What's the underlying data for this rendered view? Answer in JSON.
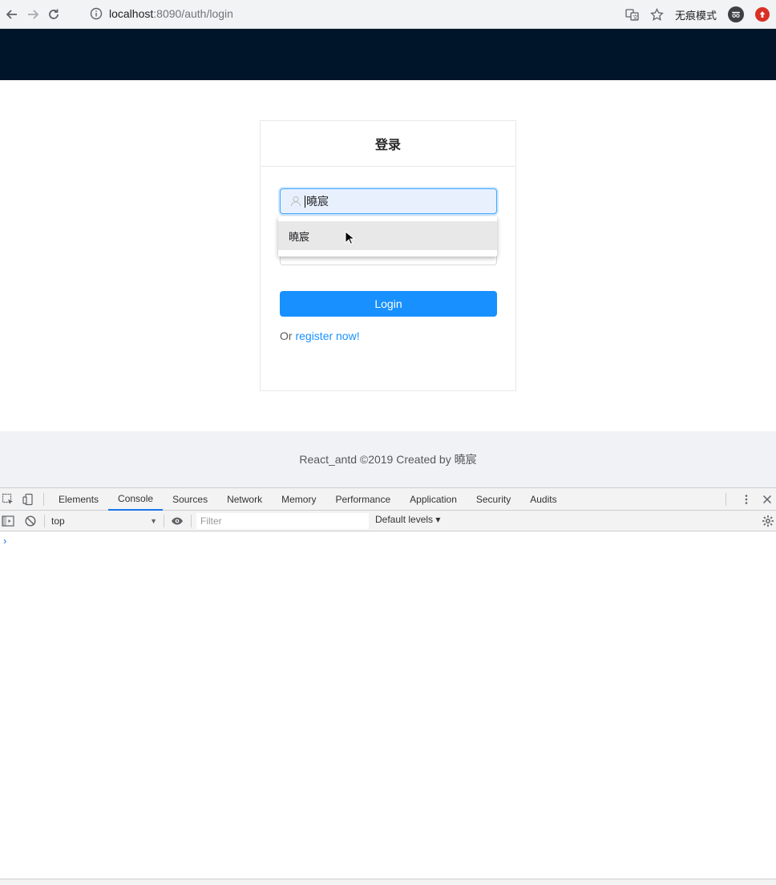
{
  "browser": {
    "url_host": "localhost",
    "url_rest": ":8090/auth/login",
    "incognito_label": "无痕模式"
  },
  "login": {
    "title": "登录",
    "username_value": "曉宸",
    "login_button": "Login",
    "register_prefix": "Or ",
    "register_link": "register now!"
  },
  "autocomplete": {
    "items": [
      "曉宸"
    ]
  },
  "footer": {
    "text": "React_antd ©2019 Created by 曉宸"
  },
  "devtools": {
    "tabs": [
      "Elements",
      "Console",
      "Sources",
      "Network",
      "Memory",
      "Performance",
      "Application",
      "Security",
      "Audits"
    ],
    "active_tab": "Console",
    "context": "top",
    "filter_placeholder": "Filter",
    "levels": "Default levels ▾",
    "prompt": "›"
  },
  "colors": {
    "header": "#001529",
    "primary": "#1890ff",
    "footer_bg": "#f0f2f5"
  }
}
